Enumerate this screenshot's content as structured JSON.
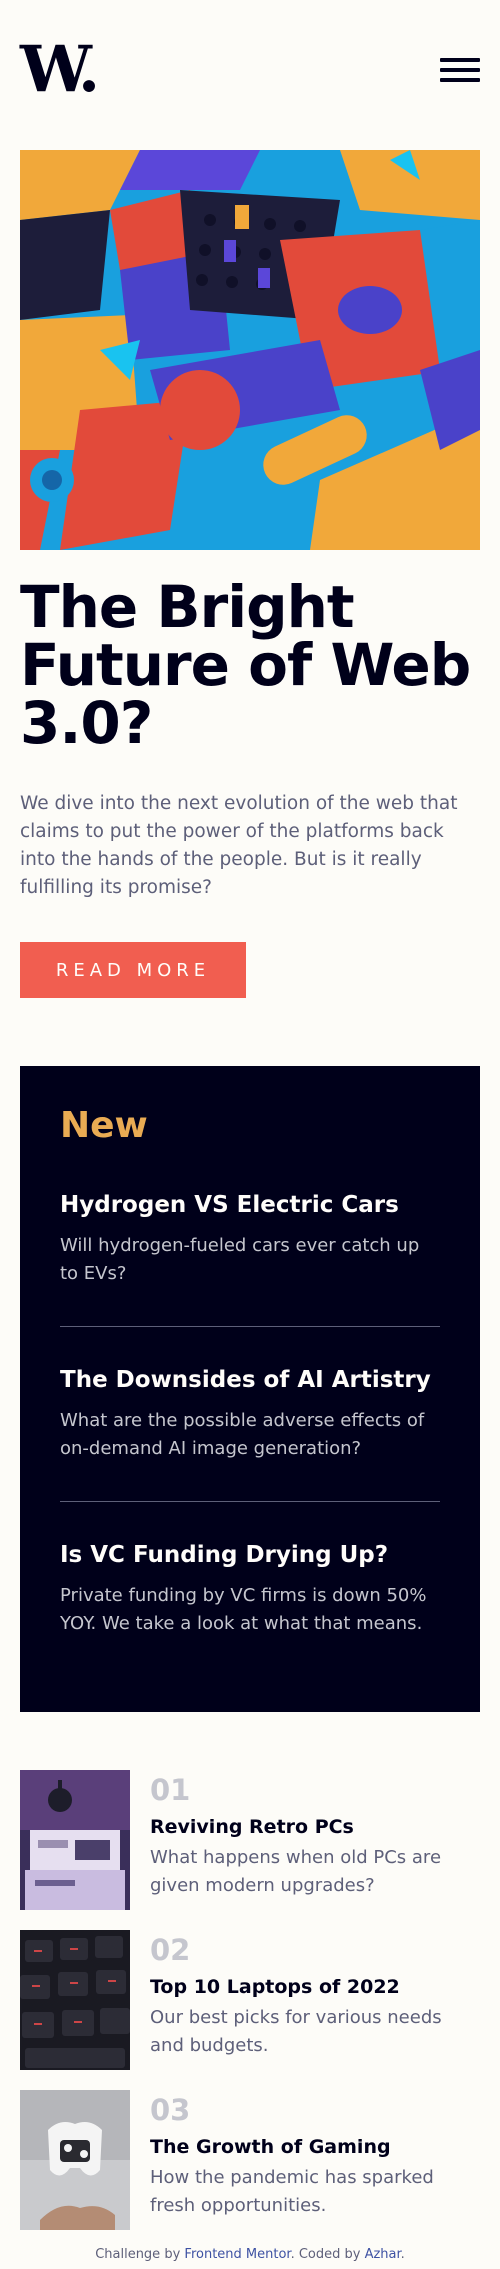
{
  "header": {
    "logo": "W.",
    "menu_icon": "hamburger-menu-icon"
  },
  "hero": {
    "title": "The Bright Future of Web 3.0?",
    "description": "We dive into the next evolution of the web that claims to put the power of the platforms back into the hands of the people. But is it really fulfilling its promise?",
    "cta": "READ MORE"
  },
  "new": {
    "heading": "New",
    "items": [
      {
        "title": "Hydrogen VS Electric Cars",
        "desc": "Will hydrogen-fueled cars ever catch up to EVs?"
      },
      {
        "title": "The Downsides of AI Artistry",
        "desc": "What are the possible adverse effects of on-demand AI image generation?"
      },
      {
        "title": "Is VC Funding Drying Up?",
        "desc": "Private funding by VC firms is down 50% YOY. We take a look at what that means."
      }
    ]
  },
  "articles": [
    {
      "num": "01",
      "title": "Reviving Retro PCs",
      "desc": "What happens when old PCs are given modern upgrades?"
    },
    {
      "num": "02",
      "title": "Top 10 Laptops of 2022",
      "desc": "Our best picks for various needs and budgets."
    },
    {
      "num": "03",
      "title": "The Growth of Gaming",
      "desc": "How the pandemic has sparked fresh opportunities."
    }
  ],
  "footer": {
    "prefix": "Challenge by ",
    "link1": "Frontend Mentor",
    "middle": ". Coded by ",
    "link2": "Azhar",
    "suffix": "."
  },
  "colors": {
    "accent": "#f15e50",
    "new_heading": "#e9ab53",
    "dark": "#00001a",
    "body_text": "#5d5f79"
  }
}
